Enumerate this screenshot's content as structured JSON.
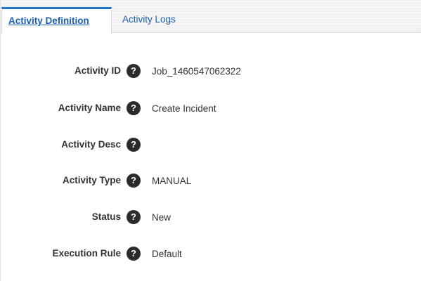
{
  "tabs": [
    {
      "label": "Activity Definition",
      "active": true
    },
    {
      "label": "Activity Logs",
      "active": false
    }
  ],
  "fields": [
    {
      "label": "Activity ID",
      "value": "Job_1460547062322",
      "help_icon": "question-circle-icon"
    },
    {
      "label": "Activity Name",
      "value": "Create Incident",
      "help_icon": "question-circle-icon"
    },
    {
      "label": "Activity Desc",
      "value": "",
      "help_icon": "question-circle-icon"
    },
    {
      "label": "Activity Type",
      "value": "MANUAL",
      "help_icon": "question-circle-icon"
    },
    {
      "label": "Status",
      "value": "New",
      "help_icon": "question-circle-icon"
    },
    {
      "label": "Execution Rule",
      "value": "Default",
      "help_icon": "question-circle-icon"
    }
  ],
  "help_glyph": "?",
  "colors": {
    "accent": "#1f73c6",
    "link": "#1a5fb4",
    "label_text": "#333333",
    "help_icon_bg": "#2b2b2b"
  }
}
